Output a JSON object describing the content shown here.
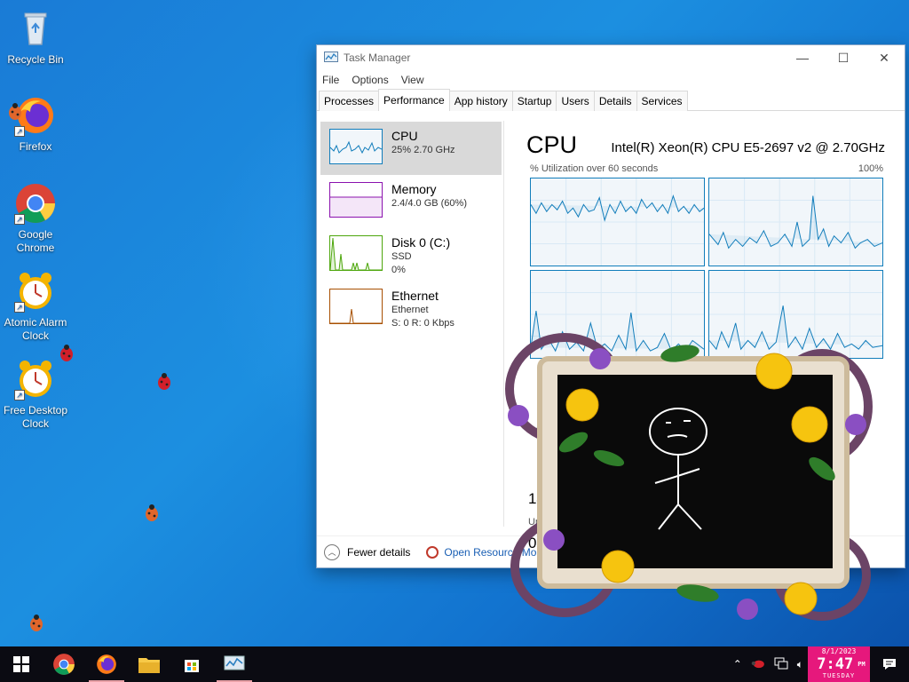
{
  "desktop": {
    "icons": [
      {
        "label": "Recycle Bin"
      },
      {
        "label": "Firefox"
      },
      {
        "label": "Google Chrome"
      },
      {
        "label": "Atomic Alarm Clock"
      },
      {
        "label": "Free Desktop Clock"
      }
    ]
  },
  "task_manager": {
    "title": "Task Manager",
    "menu": [
      "File",
      "Options",
      "View"
    ],
    "tabs": [
      "Processes",
      "Performance",
      "App history",
      "Startup",
      "Users",
      "Details",
      "Services"
    ],
    "active_tab": "Performance",
    "perf_items": [
      {
        "name": "CPU",
        "line1": "25% 2.70 GHz",
        "line2": "",
        "line3": "",
        "color": "#117dbb"
      },
      {
        "name": "Memory",
        "line1": "2.4/4.0 GB (60%)",
        "line2": "",
        "line3": "",
        "color": "#8b12ae"
      },
      {
        "name": "Disk 0 (C:)",
        "line1": "SSD",
        "line2": "0%",
        "line3": "",
        "color": "#4da60c"
      },
      {
        "name": "Ethernet",
        "line1": "Ethernet",
        "line2": "S: 0 R: 0 Kbps",
        "line3": "",
        "color": "#a74f01"
      }
    ],
    "cpu_title": "CPU",
    "cpu_model": "Intel(R) Xeon(R) CPU E5-2697 v2 @ 2.70GHz",
    "util_label": "% Utilization over 60 seconds",
    "util_max": "100%",
    "partial_texts": [
      "Ut",
      "14",
      "Up",
      "0:"
    ],
    "footer": {
      "fewer_details": "Fewer details",
      "open_resource_monitor": "Open Resource Mon"
    }
  },
  "taskbar": {
    "clock": {
      "date": "8/1/2023",
      "time": "7:47",
      "ampm": "PM",
      "weekday": "TUESDAY"
    }
  }
}
